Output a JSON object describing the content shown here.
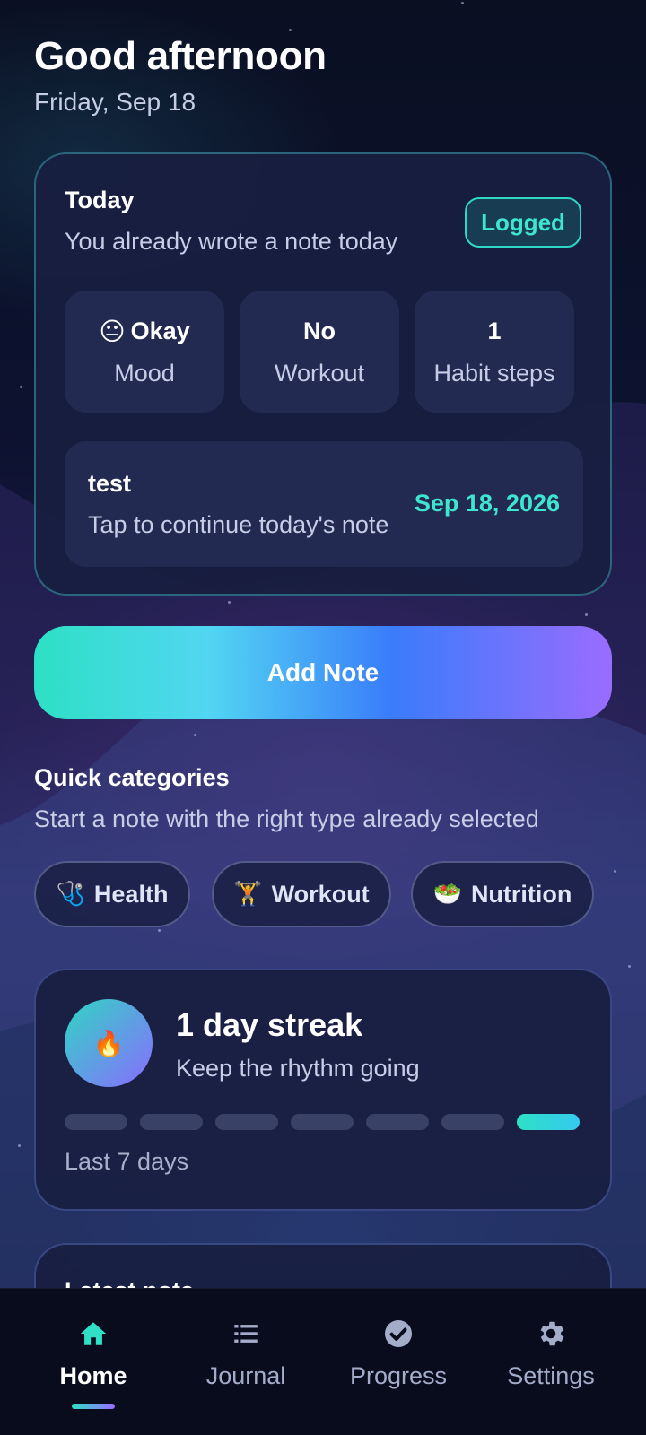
{
  "header": {
    "greeting": "Good afternoon",
    "date": "Friday, Sep 18"
  },
  "today": {
    "title": "Today",
    "subtitle": "You already wrote a note today",
    "badge": "Logged",
    "stats": [
      {
        "value": "Okay",
        "emoji": "😐",
        "label": "Mood"
      },
      {
        "value": "No",
        "label": "Workout"
      },
      {
        "value": "1",
        "label": "Habit steps"
      }
    ],
    "note": {
      "title": "test",
      "subtitle": "Tap to continue today's note",
      "date": "Sep 18, 2026"
    }
  },
  "add_note_label": "Add Note",
  "quick_categories": {
    "title": "Quick categories",
    "subtitle": "Start a note with the right type already selected",
    "chips": [
      {
        "label": "Health",
        "icon": "stethoscope-icon",
        "emoji": "🩺"
      },
      {
        "label": "Workout",
        "icon": "weightlifter-icon",
        "emoji": "🏋"
      },
      {
        "label": "Nutrition",
        "icon": "salad-icon",
        "emoji": "🥗"
      }
    ]
  },
  "streak": {
    "title": "1 day streak",
    "subtitle": "Keep the rhythm going",
    "icon": "flame-icon",
    "icon_glyph": "🔥",
    "days_active": [
      false,
      false,
      false,
      false,
      false,
      false,
      true
    ],
    "footer": "Last 7 days"
  },
  "latest": {
    "title": "Latest note"
  },
  "nav": {
    "items": [
      {
        "label": "Home",
        "icon": "home-icon",
        "active": true
      },
      {
        "label": "Journal",
        "icon": "list-icon",
        "active": false
      },
      {
        "label": "Progress",
        "icon": "check-circle-icon",
        "active": false
      },
      {
        "label": "Settings",
        "icon": "gear-icon",
        "active": false
      }
    ]
  },
  "colors": {
    "accent_teal": "#3ee6d0",
    "accent_purple": "#9a6cff",
    "card_bg": "#181e40"
  }
}
